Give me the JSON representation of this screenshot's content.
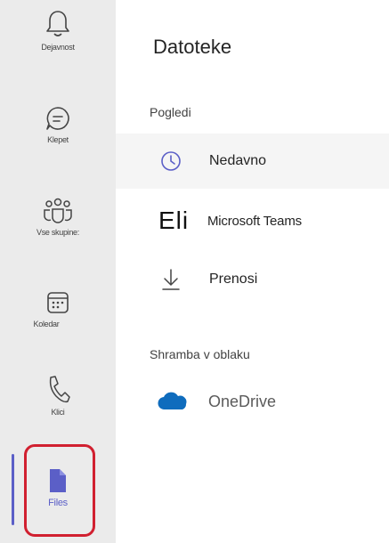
{
  "rail": {
    "items": [
      {
        "label": "Dejavnost",
        "icon": "bell-icon"
      },
      {
        "label": "Klepet",
        "icon": "chat-icon"
      },
      {
        "label": "Vse skupine:",
        "icon": "teams-icon"
      },
      {
        "label": "Koledar",
        "icon": "calendar-icon"
      },
      {
        "label": "Klici",
        "icon": "phone-icon"
      },
      {
        "label": "Files",
        "icon": "file-icon"
      }
    ]
  },
  "panel": {
    "title": "Datoteke",
    "views_section": "Pogledi",
    "views": [
      {
        "label": "Nedavno",
        "icon": "clock-icon",
        "selected": true
      },
      {
        "prefix": "Eli",
        "label": "Microsoft Teams"
      },
      {
        "label": "Prenosi",
        "icon": "download-icon"
      }
    ],
    "cloud_section": "Shramba v oblaku",
    "cloud": [
      {
        "label": "OneDrive",
        "icon": "onedrive-icon"
      }
    ]
  },
  "colors": {
    "accent": "#5b5fc7",
    "highlight": "#d12030",
    "onedrive": "#0f6cbd",
    "rail_bg": "#ebebeb"
  }
}
